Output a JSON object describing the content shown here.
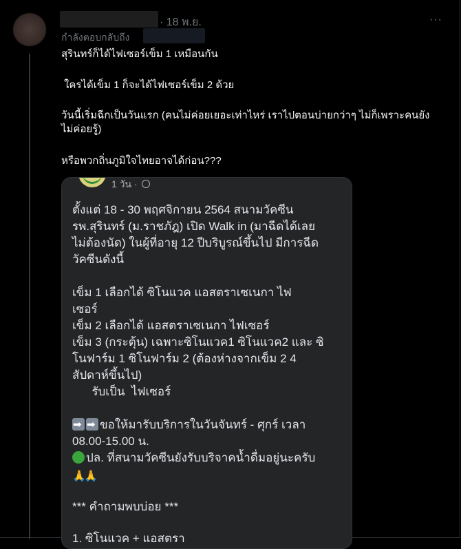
{
  "post": {
    "time": "· 18 พ.ย.",
    "more": "···",
    "reply_prefix": "กำลังตอบกลับถึง",
    "lines": [
      "สุรินทร์ก็ได้ไฟเซอร์เข็ม 1 เหมือนกัน",
      "ใครได้เข็ม 1 ก็จะได้ไฟเซอร์เข็ม 2 ด้วย",
      "วันนี้เริ่มฉีกเป็นวันแรก (คนไม่ค่อยเยอะเท่าไหร่ เราไปตอนบ่ายกว่าๆ ไม่ก็เพราะคนยัง",
      "ไม่ค่อยรู้)",
      "หรือพวกถิ่นภูมิใจไทยอาจได้ก่อน???"
    ]
  },
  "card": {
    "meta": "1 วัน ·",
    "lines": [
      "ตั้งแต่ 18 - 30 พฤศจิกายน 2564 สนามวัคซีน",
      "รพ.สุรินทร์ (ม.ราชภัฎ) เปิด Walk in (มาฉีดได้เลย",
      "ไม่ต้องนัด) ในผู้ที่อายุ 12 ปีบริบูรณ์ขึ้นไป  มีการฉีด",
      "วัคซีนดังนี้",
      "เข็ม 1  เลือกได้  ซิโนแวค   แอสตราเซเนกา   ไฟ",
      "เซอร์",
      "เข็ม 2 เลือกได้   แอสตราเซเนกา   ไฟเซอร์",
      "เข็ม 3 (กระตุ้น) เฉพาะซิโนแวค1 ซิโนแวค2 และ ซิ",
      "โนฟาร์ม 1 ซิโนฟาร์ม 2  (ต้องห่างจากเข็ม 2  4",
      "สัปดาห์ขึ้นไป)",
      "      รับเป็น  ไฟเซอร์",
      "ขอให้มารับบริการในวันจันทร์ - ศุกร์ เวลา",
      "08.00-15.00 น.",
      "ปล. ที่สนามวัคซีนยังรับบริจาคน้ำดื่มอยู่นะครับ",
      "*** คำถามพบบ่อย ***",
      "1. ซิโนแวค + แอสตรา"
    ]
  }
}
